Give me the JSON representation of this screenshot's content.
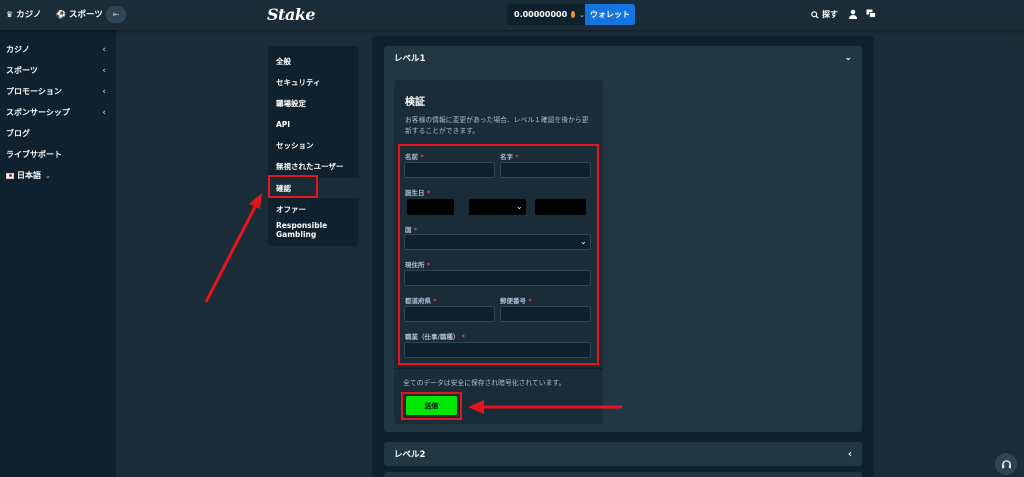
{
  "topbar": {
    "casino_tab": "カジノ",
    "sports_tab": "スポーツ",
    "logo": "Stake",
    "balance": "0.00000000",
    "wallet_button": "ウォレット",
    "search_label": "探す"
  },
  "sidebar": {
    "items": [
      {
        "label": "カジノ"
      },
      {
        "label": "スポーツ"
      },
      {
        "label": "プロモーション"
      },
      {
        "label": "スポンサーシップ"
      },
      {
        "label": "ブログ"
      },
      {
        "label": "ライブサポート"
      }
    ],
    "language": "日本語"
  },
  "settings_nav": {
    "items": [
      {
        "label": "全般"
      },
      {
        "label": "セキュリティ"
      },
      {
        "label": "職場設定"
      },
      {
        "label": "API"
      },
      {
        "label": "セッション"
      },
      {
        "label": "無視されたユーザー"
      },
      {
        "label": "確認"
      },
      {
        "label": "オファー"
      },
      {
        "label": "Responsible Gambling"
      }
    ],
    "active_index": 6
  },
  "levels": {
    "level1": "レベル1",
    "level2": "レベル2"
  },
  "form": {
    "title": "検証",
    "description": "お客様の情報に変更があった場合、レベル１確認を後から更新することができます。",
    "first_name": "名前",
    "last_name": "名字",
    "birthdate": "誕生日",
    "country": "国",
    "address": "現住所",
    "prefecture": "都道府県",
    "postal_code": "郵便番号",
    "occupation": "職業（仕事/職種）",
    "required_mark": "*",
    "secure_note": "全てのデータは安全に保存され暗号化されています。",
    "submit": "送信"
  },
  "colors": {
    "page_bg": "#1a2c38",
    "panel_bg": "#0f212e",
    "accent_blue": "#1475e1",
    "submit_green": "#00e701",
    "annotation_red": "#e8141c"
  }
}
